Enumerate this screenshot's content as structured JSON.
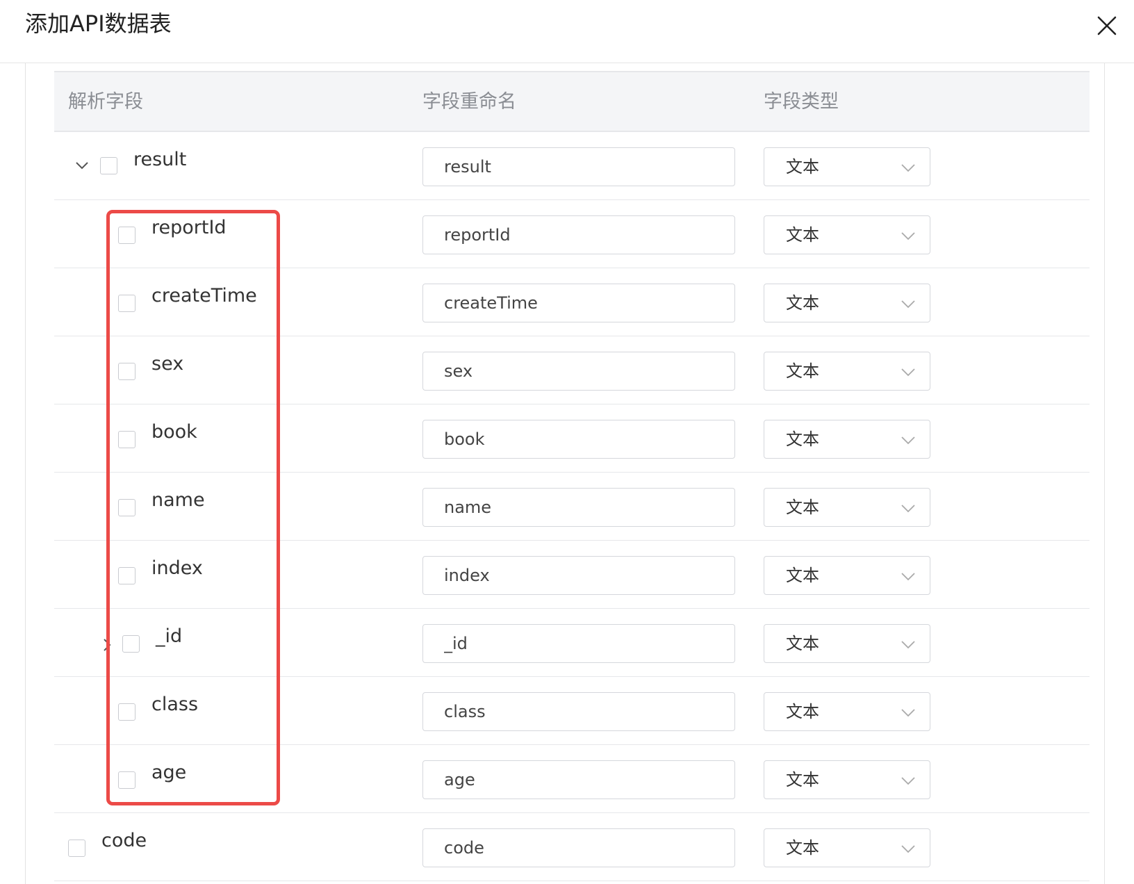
{
  "dialog": {
    "title": "添加API数据表",
    "close_icon": "close-icon"
  },
  "table": {
    "headers": [
      "解析字段",
      "字段重命名",
      "字段类型"
    ],
    "rows": [
      {
        "field": "result",
        "rename": "result",
        "type": "文本",
        "level": 0,
        "caret": "expanded"
      },
      {
        "field": "reportId",
        "rename": "reportId",
        "type": "文本",
        "level": 1
      },
      {
        "field": "createTime",
        "rename": "createTime",
        "type": "文本",
        "level": 1
      },
      {
        "field": "sex",
        "rename": "sex",
        "type": "文本",
        "level": 1
      },
      {
        "field": "book",
        "rename": "book",
        "type": "文本",
        "level": 1
      },
      {
        "field": "name",
        "rename": "name",
        "type": "文本",
        "level": 1
      },
      {
        "field": "index",
        "rename": "index",
        "type": "文本",
        "level": 1
      },
      {
        "field": "_id",
        "rename": "_id",
        "type": "文本",
        "level": 1,
        "caret": "collapsed"
      },
      {
        "field": "class",
        "rename": "class",
        "type": "文本",
        "level": 1
      },
      {
        "field": "age",
        "rename": "age",
        "type": "文本",
        "level": 1
      },
      {
        "field": "code",
        "rename": "code",
        "type": "文本",
        "level": 0
      }
    ]
  },
  "highlight_color": "#ec4a47"
}
